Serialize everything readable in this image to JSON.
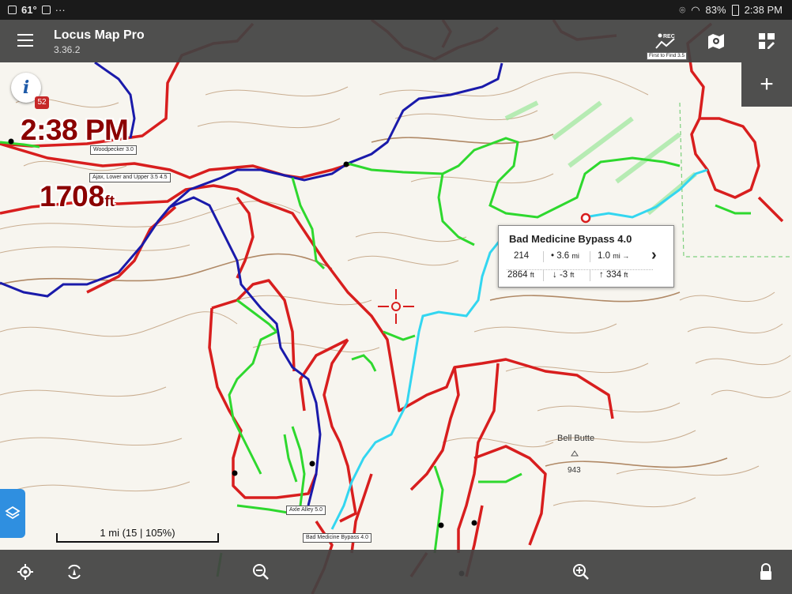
{
  "status": {
    "temperature": "61°",
    "dots": "···",
    "battery": "83%",
    "time": "2:38 PM"
  },
  "app": {
    "title": "Locus Map Pro",
    "version": "3.36.2"
  },
  "toolbar": {
    "rec_label": "First to Find 3.5",
    "icons": [
      "menu-icon",
      "track-record-icon",
      "map-visibility-icon",
      "dashboard-edit-icon",
      "add-icon"
    ]
  },
  "overlay": {
    "info_icon": "i",
    "badge_count": "52",
    "clock": "2:38 PM",
    "altitude_value": "1708",
    "altitude_unit": "ft"
  },
  "trail_labels": {
    "woodpecker": "Woodpecker 3.0",
    "ajax": "Ajax, Lower and Upper 3.5 4.5",
    "axle_alley": "Axle Alley 5.0",
    "bad_medicine": "Bad Medicine Bypass 4.0"
  },
  "terrain": {
    "bell_butte": "Bell Butte",
    "elev_943": "943"
  },
  "popup": {
    "title": "Bad Medicine Bypass 4.0",
    "id": "214",
    "distance_along": "• 3.6",
    "distance_along_unit": "mi",
    "distance_to": "1.0",
    "distance_to_unit": "mi →",
    "elevation": "2864",
    "elevation_unit": "ft",
    "descent": "↓ -3",
    "descent_unit": "ft",
    "ascent": "↑ 334",
    "ascent_unit": "ft"
  },
  "scale": {
    "text": "1 mi (15 | 105%)"
  },
  "bottom_bar": {
    "icons": [
      "gps-locate-icon",
      "rotate-map-icon",
      "zoom-out-icon",
      "zoom-in-icon",
      "lock-icon"
    ]
  },
  "colors": {
    "trail_red": "#d81e1e",
    "trail_blue": "#1a1aaa",
    "trail_green": "#2ed82e",
    "trail_cyan": "#33d6f0",
    "contour": "#c4a88c",
    "bar_bg": "#424242",
    "layers_button": "#2f8fe0"
  }
}
